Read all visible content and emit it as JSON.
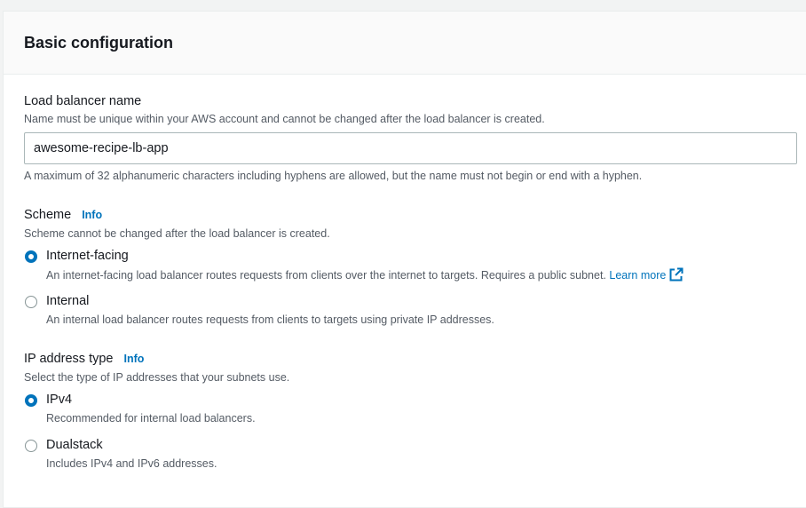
{
  "section": {
    "title": "Basic configuration"
  },
  "lb_name": {
    "label": "Load balancer name",
    "description": "Name must be unique within your AWS account and cannot be changed after the load balancer is created.",
    "value": "awesome-recipe-lb-app",
    "constraint": "A maximum of 32 alphanumeric characters including hyphens are allowed, but the name must not begin or end with a hyphen."
  },
  "scheme": {
    "label": "Scheme",
    "info": "Info",
    "description": "Scheme cannot be changed after the load balancer is created.",
    "options": [
      {
        "label": "Internet-facing",
        "description": "An internet-facing load balancer routes requests from clients over the internet to targets. Requires a public subnet.",
        "link": "Learn more",
        "link_icon": "external-link-icon",
        "selected": true
      },
      {
        "label": "Internal",
        "description": "An internal load balancer routes requests from clients to targets using private IP addresses.",
        "selected": false
      }
    ]
  },
  "ip_type": {
    "label": "IP address type",
    "info": "Info",
    "description": "Select the type of IP addresses that your subnets use.",
    "options": [
      {
        "label": "IPv4",
        "description": "Recommended for internal load balancers.",
        "selected": true
      },
      {
        "label": "Dualstack",
        "description": "Includes IPv4 and IPv6 addresses.",
        "selected": false
      }
    ]
  },
  "colors": {
    "link": "#0073bb",
    "radio_selected": "#0073bb",
    "panel_header_bg": "#fafafa"
  }
}
